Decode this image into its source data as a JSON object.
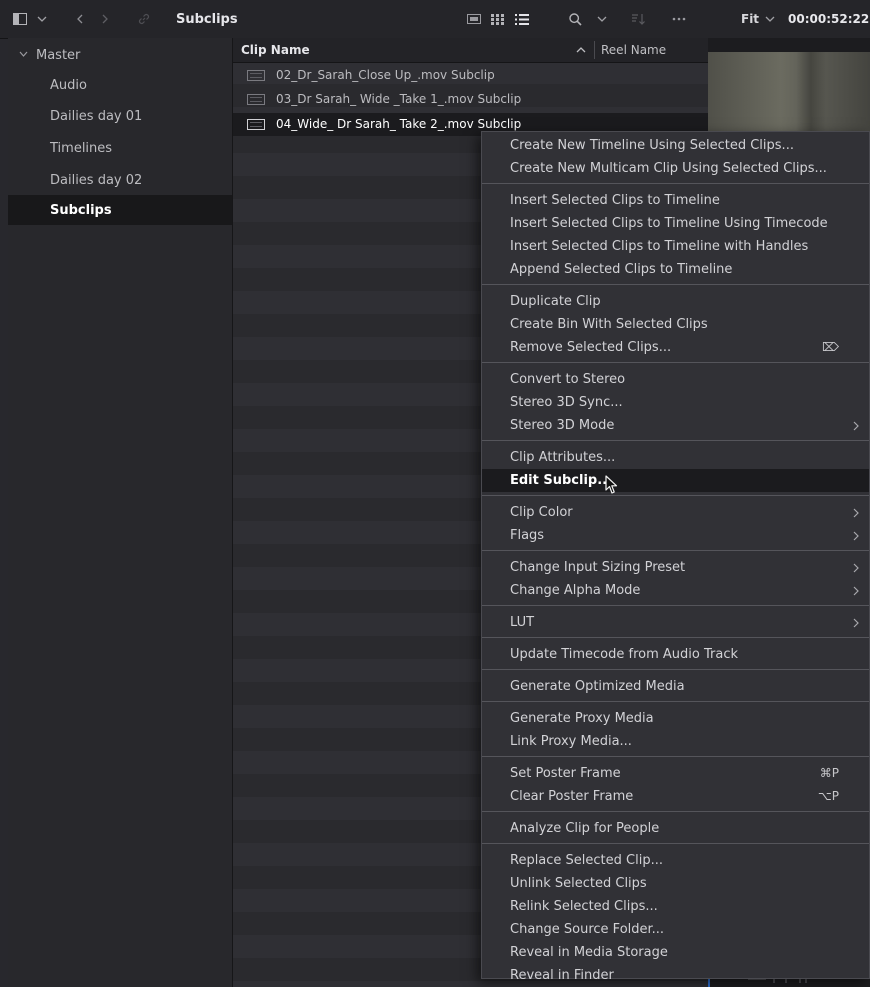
{
  "toolbar": {
    "title": "Subclips",
    "zoom": "Fit",
    "timecode": "00:00:52:22",
    "icons": [
      "panel-toggle-icon",
      "chevron-down-icon",
      "back-icon",
      "forward-icon",
      "link-icon",
      "thumbnail-view-icon",
      "grid-view-icon",
      "list-view-icon",
      "search-icon",
      "sort-icon",
      "more-icon"
    ]
  },
  "sidebar": {
    "master": "Master",
    "items": [
      {
        "label": "Audio"
      },
      {
        "label": "Dailies day 01"
      },
      {
        "label": "Timelines"
      },
      {
        "label": "Dailies day 02"
      },
      {
        "label": "Subclips",
        "selected": true
      }
    ]
  },
  "list": {
    "columns": [
      "Clip Name",
      "Reel Name"
    ],
    "rows": [
      {
        "name": "02_Dr_Sarah_Close Up_.mov Subclip"
      },
      {
        "name": "03_Dr Sarah_ Wide _Take 1_.mov Subclip"
      },
      {
        "name": "04_Wide_ Dr Sarah_ Take 2_.mov Subclip",
        "selected": true
      }
    ]
  },
  "menu": {
    "groups": [
      [
        {
          "label": "Create New Timeline Using Selected Clips..."
        },
        {
          "label": "Create New Multicam Clip Using Selected Clips..."
        }
      ],
      [
        {
          "label": "Insert Selected Clips to Timeline"
        },
        {
          "label": "Insert Selected Clips to Timeline Using Timecode"
        },
        {
          "label": "Insert Selected Clips to Timeline with Handles"
        },
        {
          "label": "Append Selected Clips to Timeline"
        }
      ],
      [
        {
          "label": "Duplicate Clip"
        },
        {
          "label": "Create Bin With Selected Clips"
        },
        {
          "label": "Remove Selected Clips...",
          "shortcut": "⌦"
        }
      ],
      [
        {
          "label": "Convert to Stereo"
        },
        {
          "label": "Stereo 3D Sync..."
        },
        {
          "label": "Stereo 3D Mode",
          "submenu": true
        }
      ],
      [
        {
          "label": "Clip Attributes..."
        },
        {
          "label": "Edit Subclip...",
          "highlighted": true
        }
      ],
      [
        {
          "label": "Clip Color",
          "submenu": true
        },
        {
          "label": "Flags",
          "submenu": true
        }
      ],
      [
        {
          "label": "Change Input Sizing Preset",
          "submenu": true
        },
        {
          "label": "Change Alpha Mode",
          "submenu": true
        }
      ],
      [
        {
          "label": "LUT",
          "submenu": true
        }
      ],
      [
        {
          "label": "Update Timecode from Audio Track"
        }
      ],
      [
        {
          "label": "Generate Optimized Media"
        }
      ],
      [
        {
          "label": "Generate Proxy Media"
        },
        {
          "label": "Link Proxy Media..."
        }
      ],
      [
        {
          "label": "Set Poster Frame",
          "shortcut": "⌘P"
        },
        {
          "label": "Clear Poster Frame",
          "shortcut": "⌥P"
        }
      ],
      [
        {
          "label": "Analyze Clip for People"
        }
      ],
      [
        {
          "label": "Replace Selected Clip..."
        },
        {
          "label": "Unlink Selected Clips"
        },
        {
          "label": "Relink Selected Clips..."
        },
        {
          "label": "Change Source Folder..."
        },
        {
          "label": "Reveal in Media Storage"
        },
        {
          "label": "Reveal in Finder"
        }
      ]
    ]
  },
  "colors": {
    "background": "#28282d",
    "menu": "#313136",
    "highlight": "#1b1b1e",
    "text": "#d2d2d6"
  }
}
